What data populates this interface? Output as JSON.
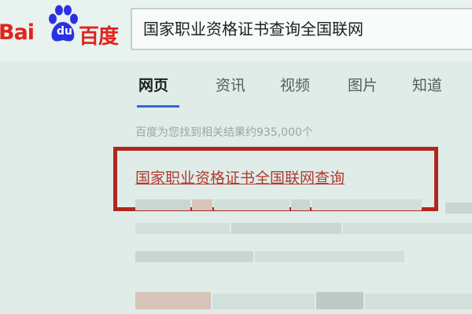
{
  "logo": {
    "text_left": "Bai",
    "text_mid": "du",
    "text_right": "百度"
  },
  "search": {
    "query": "国家职业资格证书查询全国联网"
  },
  "tabs": [
    {
      "label": "网页",
      "active": true
    },
    {
      "label": "资讯",
      "active": false
    },
    {
      "label": "视频",
      "active": false
    },
    {
      "label": "图片",
      "active": false
    },
    {
      "label": "知道",
      "active": false
    }
  ],
  "results": {
    "count_text": "百度为您找到相关结果约935,000个",
    "first_title": "国家职业资格证书全国联网查询"
  },
  "colors": {
    "brand_red": "#e2231a",
    "brand_blue": "#2932e1",
    "link": "#b33a30",
    "highlight": "#b0261f",
    "tab_active_underline": "#3366dd"
  }
}
